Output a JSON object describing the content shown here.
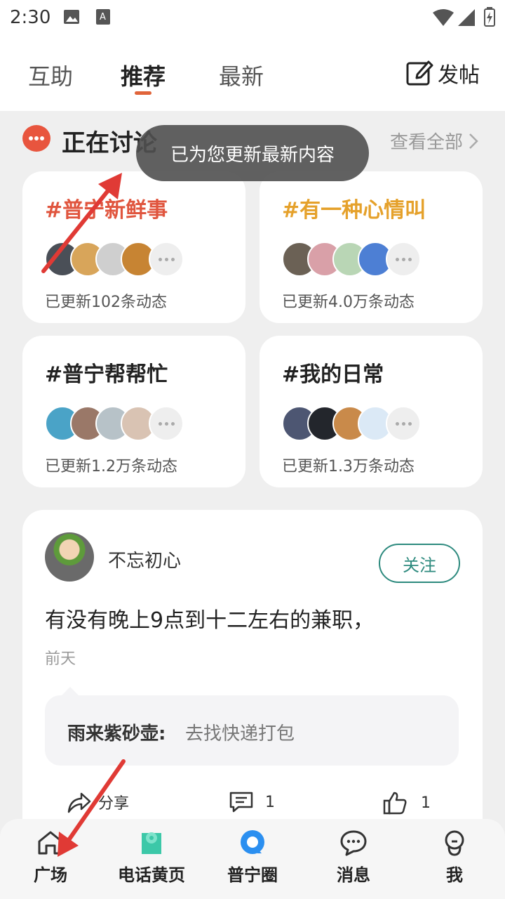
{
  "status_bar": {
    "time": "2:30"
  },
  "nav": {
    "tabs": [
      {
        "label": "互助"
      },
      {
        "label": "推荐"
      },
      {
        "label": "最新"
      }
    ],
    "post_label": "发帖",
    "accent_color": "#e0643a"
  },
  "discussion": {
    "title": "正在讨论",
    "view_all": "查看全部",
    "toast": "已为您更新最新内容",
    "topics": [
      {
        "title": "#普宁新鲜事",
        "count": "已更新102条动态",
        "color": "#e0553e"
      },
      {
        "title": "#有一种心情叫",
        "count": "已更新4.0万条动态",
        "color": "#e5a12b"
      },
      {
        "title": "#普宁帮帮忙",
        "count": "已更新1.2万条动态",
        "color": "#222222"
      },
      {
        "title": "#我的日常",
        "count": "已更新1.3万条动态",
        "color": "#222222"
      }
    ]
  },
  "post": {
    "username": "不忘初心",
    "follow_label": "关注",
    "text": "有没有晚上9点到十二左右的兼职，",
    "time": "前天",
    "comment": {
      "author": "雨来紫砂壶:",
      "text": "去找快递打包"
    },
    "actions": {
      "share": "分享",
      "comments": "1",
      "likes": "1"
    }
  },
  "bottom_nav": {
    "items": [
      {
        "label": "广场"
      },
      {
        "label": "电话黄页"
      },
      {
        "label": "普宁圈"
      },
      {
        "label": "消息"
      },
      {
        "label": "我"
      }
    ]
  }
}
